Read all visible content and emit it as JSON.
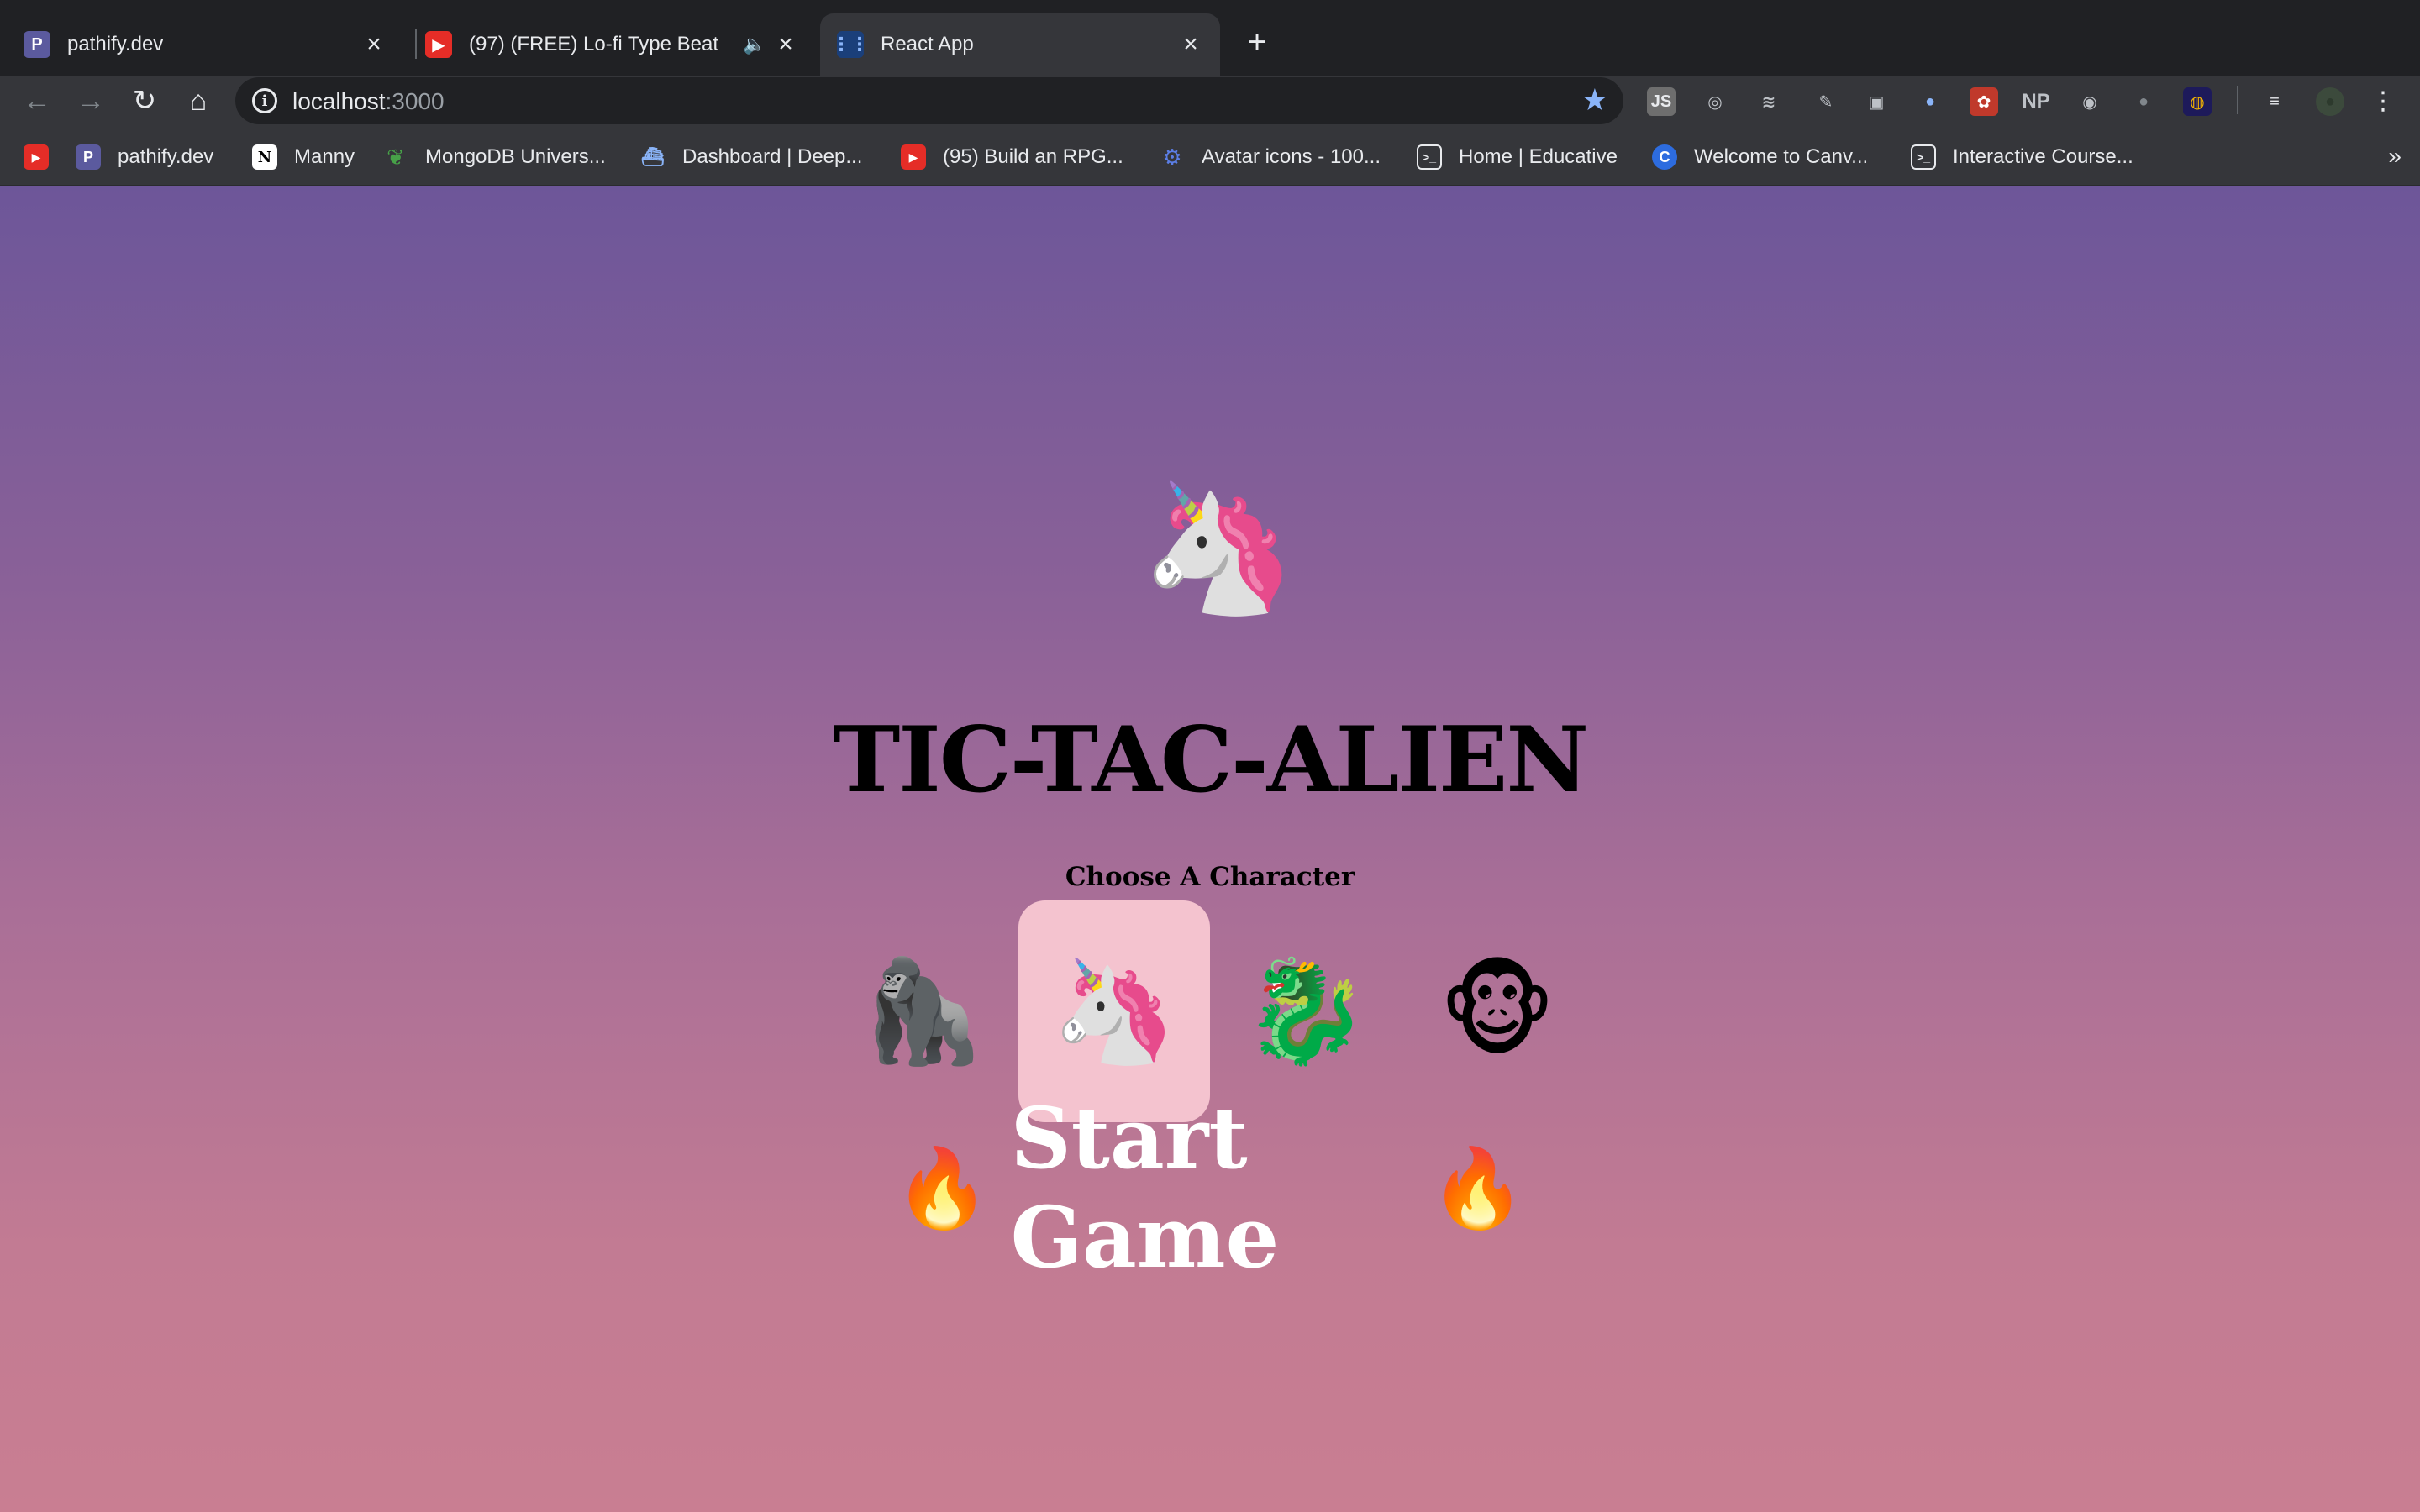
{
  "browser": {
    "tabs": [
      {
        "title": "pathify.dev",
        "favicon": "P",
        "favicon_color": "#5b5a9e",
        "active": false
      },
      {
        "title": "(97) (FREE) Lo-fi Type Beat",
        "favicon": "youtube-icon",
        "favicon_color": "#e52d27",
        "active": false,
        "audio": true
      },
      {
        "title": "React App",
        "favicon": "grid-icon",
        "favicon_color": "#1a73e8",
        "active": true
      }
    ],
    "address": {
      "host": "localhost",
      "port": ":3000"
    },
    "extensions": [
      "JS",
      "◎",
      "≋",
      "✎",
      "▣",
      "●",
      "✿",
      "NP",
      "◉",
      "●",
      "◍",
      "≡",
      "●"
    ],
    "bookmarks": [
      {
        "label": "",
        "icon": "youtube-icon",
        "color": "#e52d27"
      },
      {
        "label": "pathify.dev",
        "icon": "P",
        "color": "#5b5a9e"
      },
      {
        "label": "Manny",
        "icon": "N",
        "color": "#ffffff"
      },
      {
        "label": "MongoDB Univers...",
        "icon": "leaf-icon",
        "color": "#47a248"
      },
      {
        "label": "Dashboard | Deep...",
        "icon": "sub-icon",
        "color": "#4b6cd6"
      },
      {
        "label": "(95) Build an RPG...",
        "icon": "youtube-icon",
        "color": "#e52d27"
      },
      {
        "label": "Avatar icons - 100...",
        "icon": "gear-icon",
        "color": "#5b7ee5"
      },
      {
        "label": "Home | Educative",
        "icon": "terminal-icon",
        "color": "#e8eaed"
      },
      {
        "label": "Welcome to Canv...",
        "icon": "C",
        "color": "#2d6cdf"
      },
      {
        "label": "Interactive Course...",
        "icon": "terminal-icon",
        "color": "#e8eaed"
      }
    ],
    "more_label": "»"
  },
  "app": {
    "hero_emoji": "🦄",
    "title": "TIC-TAC-ALIEN",
    "choose_label": "Choose A Character",
    "characters": [
      {
        "emoji": "🦍",
        "selected": false
      },
      {
        "emoji": "🦄",
        "selected": true
      },
      {
        "emoji": "🐉",
        "selected": false
      },
      {
        "emoji": "🐵",
        "selected": false
      }
    ],
    "start_fire": "🔥",
    "start_label": "Start Game"
  }
}
